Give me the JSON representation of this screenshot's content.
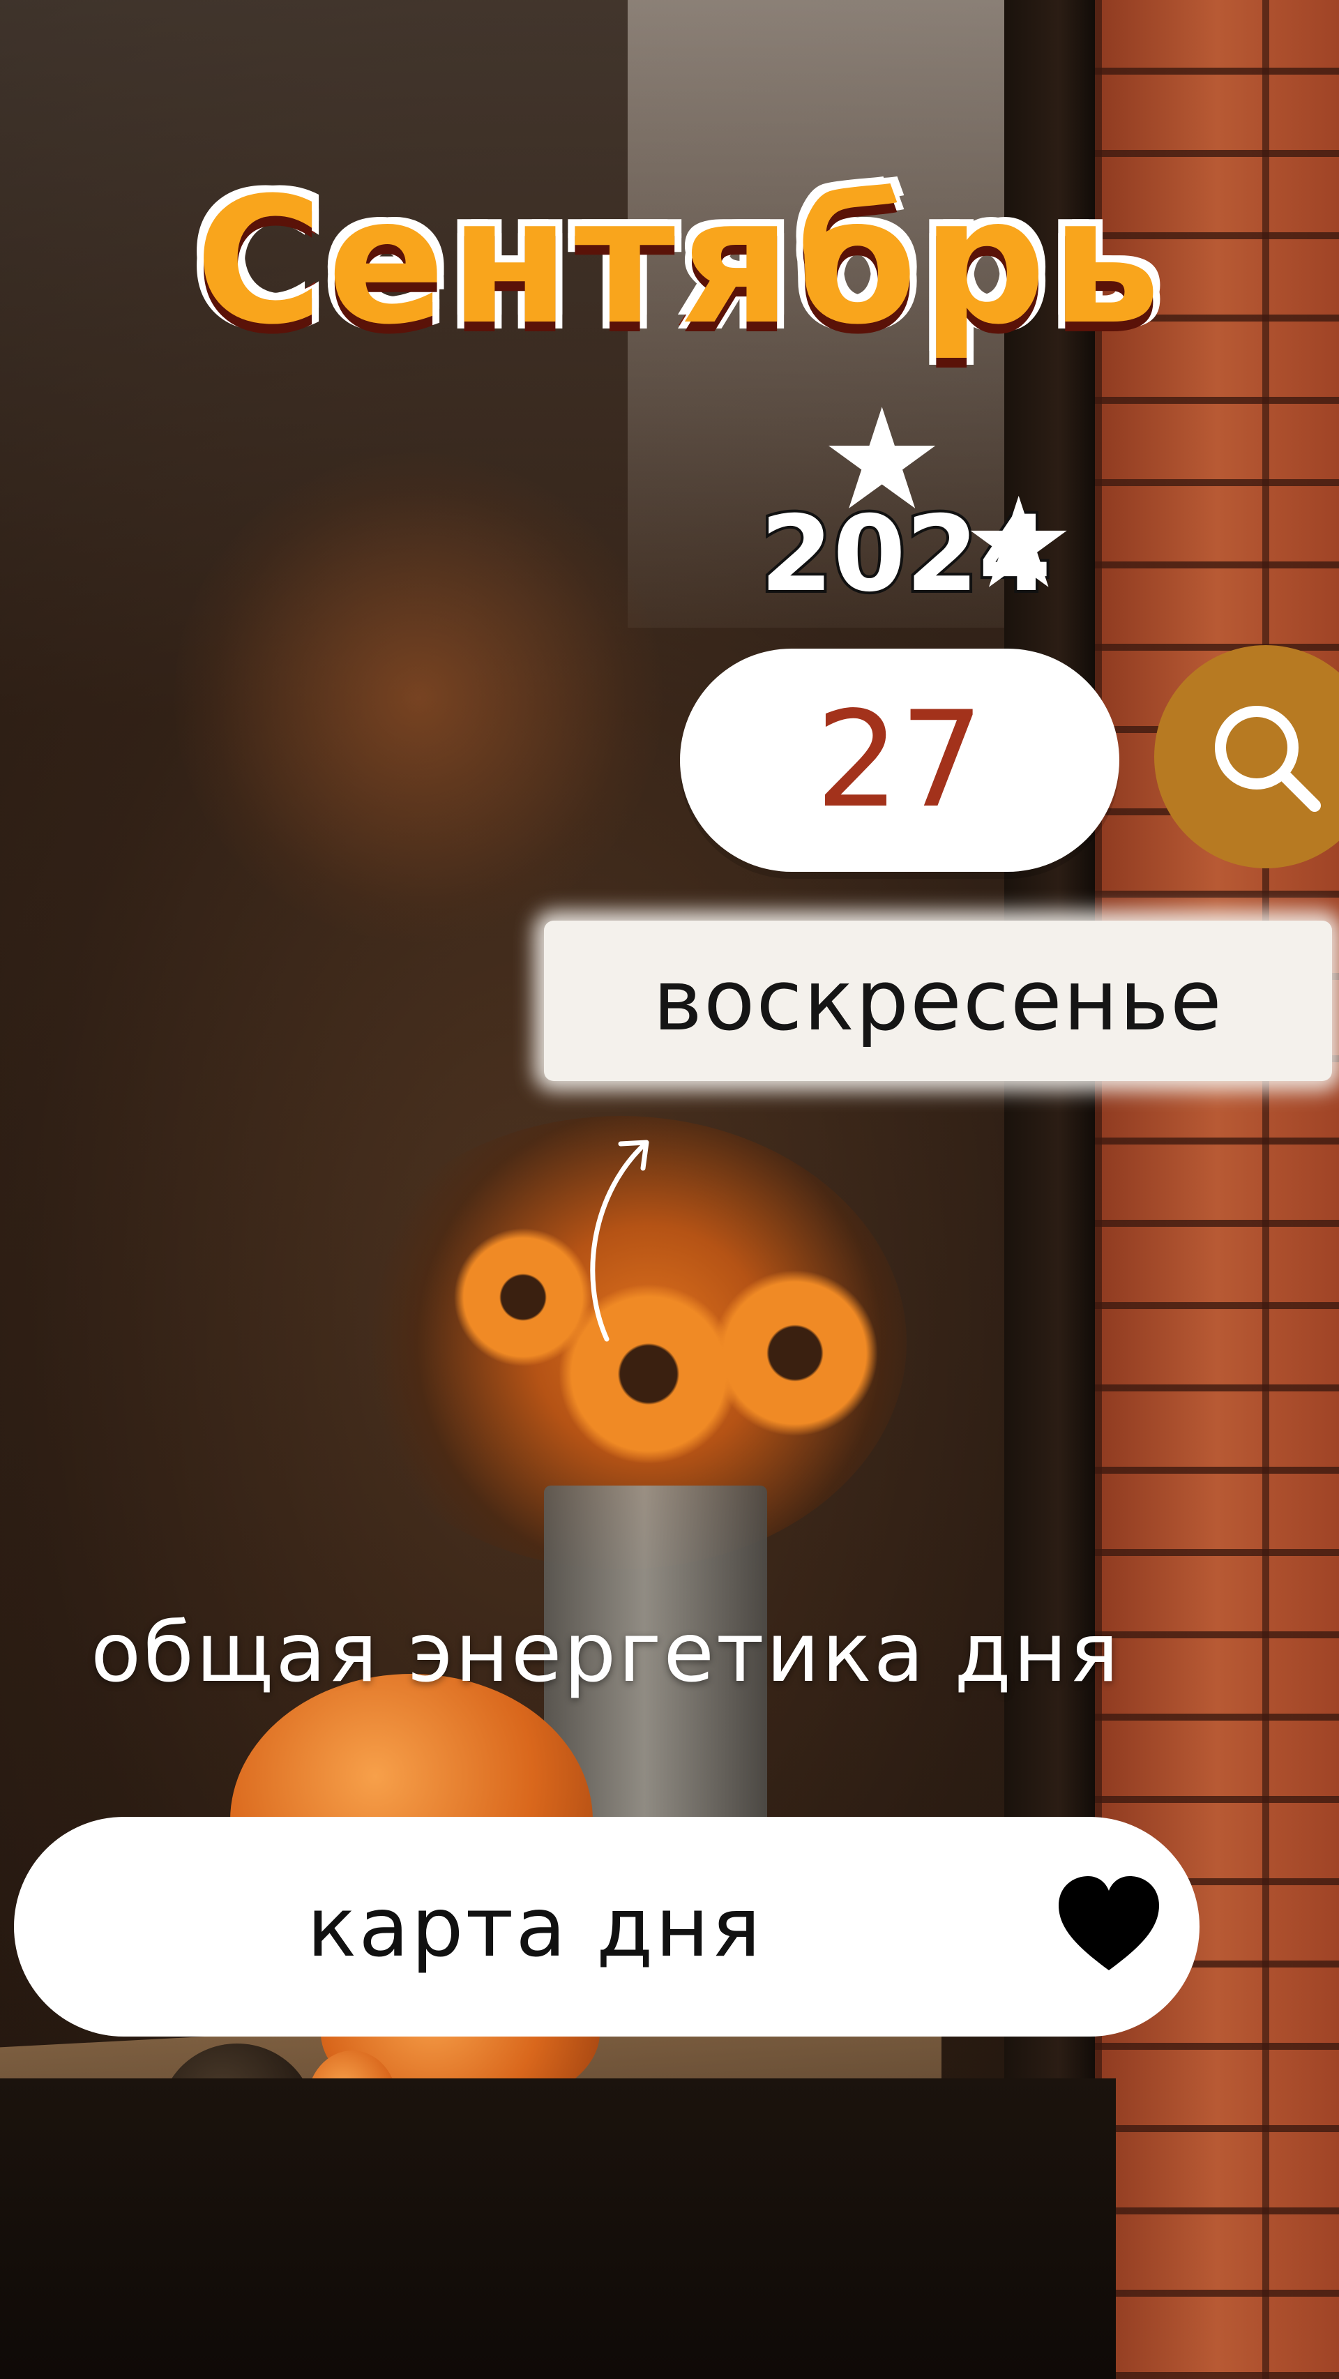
{
  "title": "Сентябрь",
  "year": "2024",
  "date": {
    "day": "27"
  },
  "weekday": "воскресенье",
  "subtitle": "общая энергетика дня",
  "card_button": {
    "label": "карта дня"
  },
  "icons": {
    "search": "search-icon",
    "heart": "heart-icon",
    "star": "star-icon",
    "arrow": "curved-arrow-icon"
  },
  "colors": {
    "title_fill": "#f9a51c",
    "title_outline": "#7a1e10",
    "day_number": "#a3321b",
    "search_bg": "#b77a22"
  }
}
